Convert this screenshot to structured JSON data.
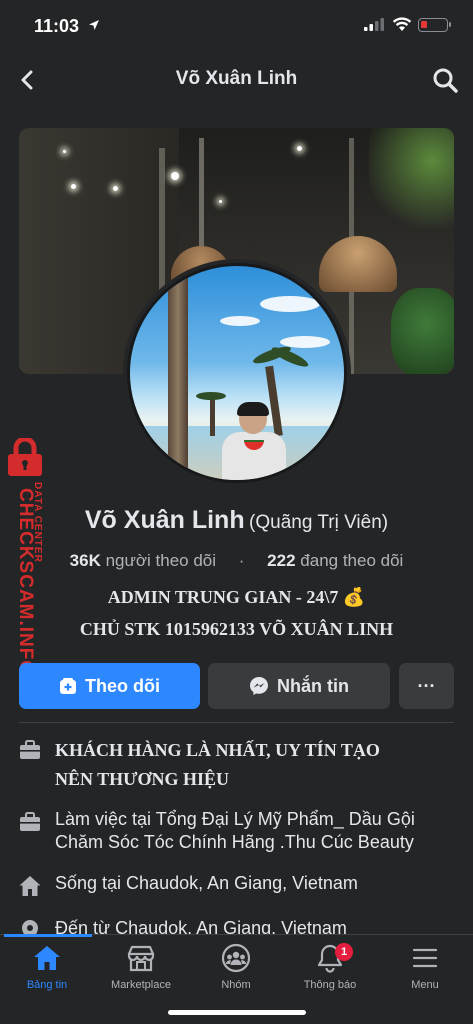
{
  "status_bar": {
    "time": "11:03"
  },
  "header": {
    "title": "Võ Xuân Linh",
    "back_icon": "chevron-left-icon",
    "search_icon": "search-icon"
  },
  "profile": {
    "name": "Võ Xuân Linh",
    "alt_name": "(Quãng Trị Viên)",
    "followers_count": "36K",
    "followers_label": "người theo dõi",
    "separator": "·",
    "following_count": "222",
    "following_label": "đang theo dõi",
    "bio_line1": "ADMIN TRUNG GIAN - 24\\7 💰",
    "bio_line2": "CHỦ STK 1015962133 VÕ XUÂN LINH"
  },
  "actions": {
    "follow_label": "Theo dõi",
    "message_label": "Nhắn tin",
    "more_label": "···"
  },
  "details": [
    {
      "icon": "briefcase-icon",
      "line1": "KHÁCH HÀNG LÀ NHẤT, UY TÍN TẠO",
      "line2": "NÊN THƯƠNG HIỆU"
    },
    {
      "icon": "briefcase-icon",
      "line1": "Làm việc tại Tổng Đại Lý Mỹ Phẩm_ Dầu Gội",
      "line2": "Chăm Sóc Tóc  Chính Hãng .Thu Cúc Beauty"
    },
    {
      "icon": "home-icon",
      "line1": "Sống tại Chaudok, An Giang, Vietnam"
    },
    {
      "icon": "location-pin-icon",
      "line1": "Đến từ Chaudok, An Giang, Vietnam"
    }
  ],
  "watermark": {
    "brand": "CHECKSCAM.INFO",
    "tagline": "DATA CENTER",
    "color": "#d42c2c"
  },
  "bottom_nav": {
    "items": [
      {
        "label": "Bảng tin",
        "icon": "home-icon",
        "active": true
      },
      {
        "label": "Marketplace",
        "icon": "marketplace-icon"
      },
      {
        "label": "Nhóm",
        "icon": "groups-icon"
      },
      {
        "label": "Thông báo",
        "icon": "bell-icon",
        "badge": "1"
      },
      {
        "label": "Menu",
        "icon": "menu-icon"
      }
    ]
  },
  "colors": {
    "accent": "#2d88ff",
    "background": "#242526",
    "badge": "#e41e3f"
  }
}
